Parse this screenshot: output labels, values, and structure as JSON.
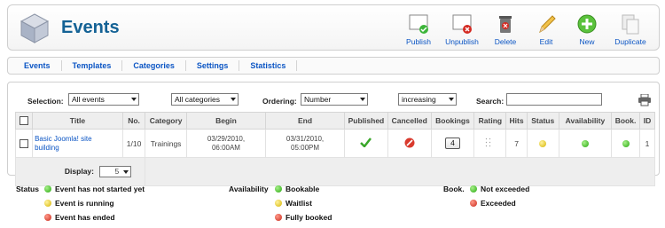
{
  "header": {
    "title": "Events",
    "toolbar": [
      {
        "label": "Publish",
        "icon": "publish-icon"
      },
      {
        "label": "Unpublish",
        "icon": "unpublish-icon"
      },
      {
        "label": "Delete",
        "icon": "trash-icon"
      },
      {
        "label": "Edit",
        "icon": "pencil-icon"
      },
      {
        "label": "New",
        "icon": "plus-icon"
      },
      {
        "label": "Duplicate",
        "icon": "copy-icon"
      }
    ]
  },
  "submenu": [
    "Events",
    "Templates",
    "Categories",
    "Settings",
    "Statistics"
  ],
  "filters": {
    "selection_label": "Selection:",
    "selection_value": "All events",
    "category_value": "All categories",
    "ordering_label": "Ordering:",
    "ordering_value": "Number",
    "direction_value": "increasing",
    "search_label": "Search:",
    "search_value": ""
  },
  "table": {
    "columns": [
      "Title",
      "No.",
      "Category",
      "Begin",
      "End",
      "Published",
      "Cancelled",
      "Bookings",
      "Rating",
      "Hits",
      "Status",
      "Availability",
      "Book.",
      "ID"
    ],
    "rows": [
      {
        "title_line1": "Basic Joomla! site",
        "title_line2": "building",
        "no": "1/10",
        "category": "Trainings",
        "begin_date": "03/29/2010,",
        "begin_time": "06:00AM",
        "end_date": "03/31/2010,",
        "end_time": "05:00PM",
        "published": "yes",
        "cancelled": "no",
        "bookings": "4",
        "hits": "7",
        "status": "yellow",
        "availability": "green",
        "book": "green",
        "id": "1"
      }
    ],
    "display_label": "Display:",
    "display_value": "5"
  },
  "legend": {
    "status": {
      "heading": "Status",
      "items": [
        {
          "color": "green",
          "label": "Event has not started yet"
        },
        {
          "color": "yellow",
          "label": "Event is running"
        },
        {
          "color": "red",
          "label": "Event has ended"
        }
      ]
    },
    "availability": {
      "heading": "Availability",
      "items": [
        {
          "color": "green",
          "label": "Bookable"
        },
        {
          "color": "yellow",
          "label": "Waitlist"
        },
        {
          "color": "red",
          "label": "Fully booked"
        }
      ]
    },
    "book": {
      "heading": "Book.",
      "items": [
        {
          "color": "green",
          "label": "Not exceeded"
        },
        {
          "color": "red",
          "label": "Exceeded"
        }
      ]
    }
  },
  "colors": {
    "link": "#0b55c4",
    "title": "#146295"
  }
}
